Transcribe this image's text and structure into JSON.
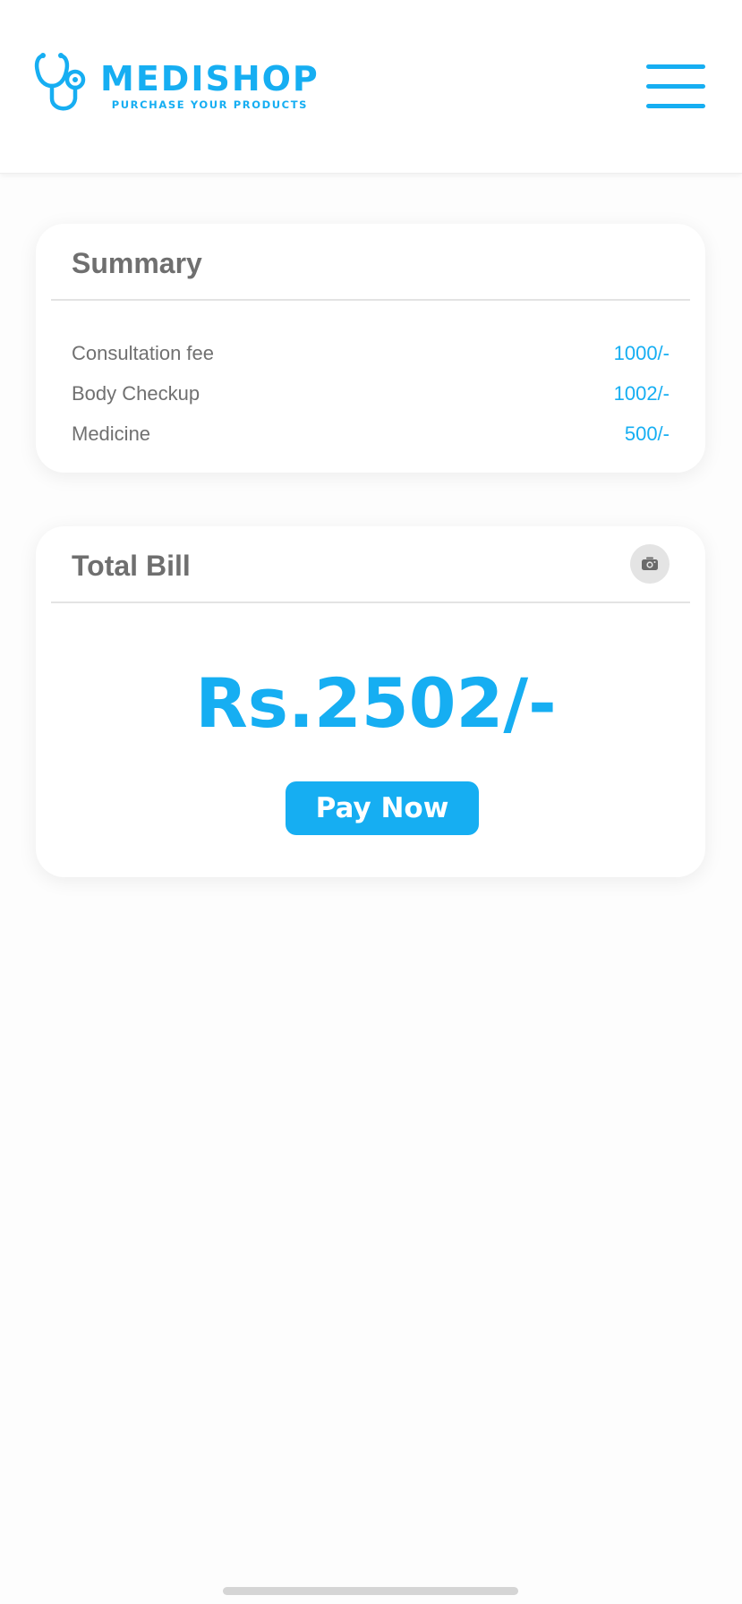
{
  "header": {
    "brand_name": "MEDISHOP",
    "tagline": "PURCHASE YOUR PRODUCTS",
    "logo_icon": "stethoscope-icon",
    "menu_icon": "hamburger-menu-icon"
  },
  "summary": {
    "title": "Summary",
    "items": [
      {
        "label": "Consultation fee",
        "value": "1000/-"
      },
      {
        "label": "Body Checkup",
        "value": "1002/-"
      },
      {
        "label": "Medicine",
        "value": "500/-"
      }
    ]
  },
  "total_bill": {
    "title": "Total Bill",
    "camera_icon": "camera-icon",
    "amount": "Rs.2502/-",
    "pay_button_label": "Pay Now"
  },
  "colors": {
    "accent": "#16aef2",
    "text_muted": "#707070",
    "card_background": "#ffffff",
    "page_background": "#fdfdfd"
  }
}
